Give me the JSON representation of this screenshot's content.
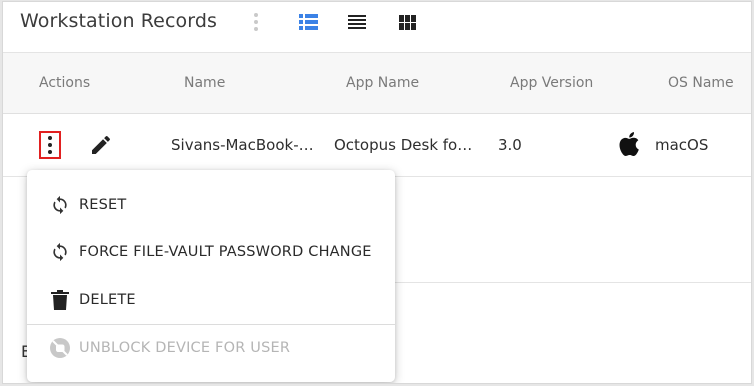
{
  "header": {
    "title": "Workstation Records"
  },
  "view_toggles": [
    {
      "icon": "kebab-vertical-icon",
      "active": false
    },
    {
      "icon": "list-view-icon",
      "active": true
    },
    {
      "icon": "compact-list-icon",
      "active": false
    },
    {
      "icon": "grid-view-icon",
      "active": false
    }
  ],
  "table": {
    "columns": [
      "Actions",
      "Name",
      "App Name",
      "App Version",
      "OS Name"
    ],
    "rows": [
      {
        "name": "Sivans-MacBook-…",
        "app_name": "Octopus Desk fo…",
        "app_version": "3.0",
        "os_icon": "apple-icon",
        "os_name": "macOS"
      }
    ]
  },
  "partial_text": "E",
  "context_menu": {
    "items": [
      {
        "label": "RESET",
        "icon": "refresh-icon",
        "enabled": true
      },
      {
        "label": "FORCE FILE-VAULT PASSWORD CHANGE",
        "icon": "refresh-icon",
        "enabled": true
      },
      {
        "label": "DELETE",
        "icon": "trash-icon",
        "enabled": true
      },
      {
        "label": "UNBLOCK DEVICE FOR USER",
        "icon": "block-icon",
        "enabled": false
      }
    ]
  },
  "colors": {
    "accent": "#3b82e6",
    "highlight_border": "#e12020",
    "header_bg": "#f7f7f7",
    "disabled_text": "#b5b5b5"
  }
}
